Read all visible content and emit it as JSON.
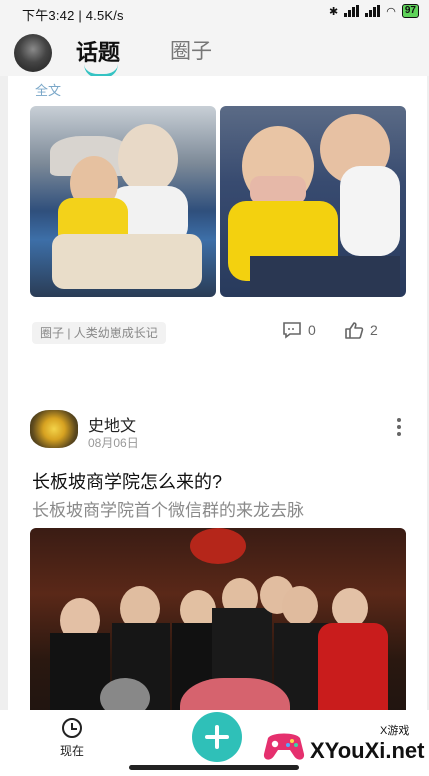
{
  "statusbar": {
    "left_text": "下午3:42 | 4.5K/s",
    "battery": "97"
  },
  "header": {
    "tabs": [
      {
        "label": "话题",
        "active": true
      },
      {
        "label": "圈子",
        "active": false
      }
    ]
  },
  "feed": {
    "card1": {
      "read_more": "全文",
      "tag": "圈子 | 人类幼崽成长记",
      "comments": "0",
      "likes": "2"
    },
    "card2": {
      "author": "史地文",
      "date": "08月06日",
      "title": "长板坡商学院怎么来的?",
      "subtitle": "长板坡商学院首个微信群的来龙去脉"
    }
  },
  "bottom_nav": {
    "now_label": "现在"
  },
  "watermark": {
    "big": "XYouXi.net",
    "small": "X游戏"
  },
  "colors": {
    "accent": "#2fc0b8",
    "tab_indicator": "#35c3c3"
  }
}
